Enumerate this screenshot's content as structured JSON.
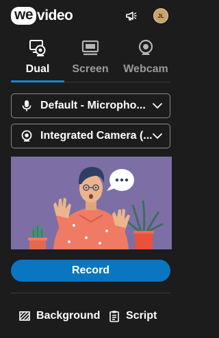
{
  "brand": {
    "logo_part1": "we",
    "logo_part2": "video"
  },
  "header": {
    "avatar_initials": "JL"
  },
  "tabs": [
    {
      "label": "Dual",
      "active": true,
      "icon": "dual-icon"
    },
    {
      "label": "Screen",
      "active": false,
      "icon": "screen-icon"
    },
    {
      "label": "Webcam",
      "active": false,
      "icon": "webcam-icon"
    }
  ],
  "devices": {
    "microphone": {
      "value": "Default - Micropho...",
      "icon": "microphone-icon"
    },
    "camera": {
      "value": "Integrated Camera (...",
      "icon": "camera-icon"
    }
  },
  "preview": {
    "bubble_text": "•••"
  },
  "actions": {
    "record_label": "Record"
  },
  "bottom": {
    "background_label": "Background",
    "script_label": "Script"
  },
  "colors": {
    "accent": "#1b87d4",
    "record": "#0a76c1",
    "background": "#1c1c1c",
    "preview_bg": "#7d6fa6"
  }
}
